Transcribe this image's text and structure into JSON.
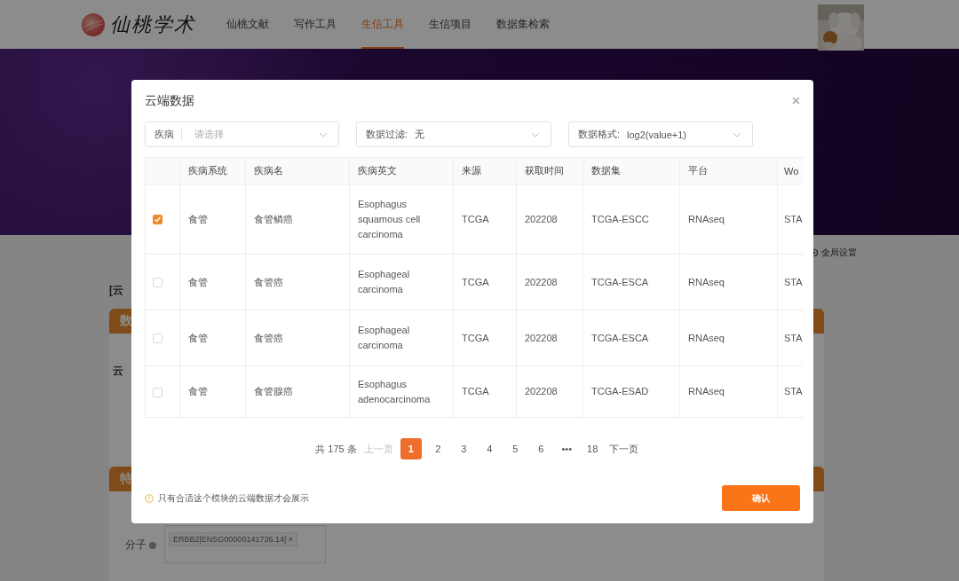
{
  "nav": {
    "logo_text": "仙桃学术",
    "items": [
      {
        "label": "仙桃文献",
        "selected": false
      },
      {
        "label": "写作工具",
        "selected": false
      },
      {
        "label": "生信工具",
        "selected": true
      },
      {
        "label": "生信项目",
        "selected": false
      },
      {
        "label": "数据集检索",
        "selected": false
      }
    ]
  },
  "page": {
    "settings_link": "全局设置",
    "heading": "[云",
    "panels": [
      {
        "header": "数",
        "field_label": "云"
      },
      {
        "header": "特",
        "field_label": "分子",
        "tag": "ERBB2|ENSG00000141736.14|",
        "tag_close": "×"
      }
    ]
  },
  "modal": {
    "title": "云端数据",
    "filters": [
      {
        "kind": "prefixed",
        "label": "疾病",
        "placeholder": "请选择"
      },
      {
        "kind": "inline",
        "label": "数据过滤:",
        "value": "无"
      },
      {
        "kind": "inline",
        "label": "数据格式:",
        "value": "log2(value+1)"
      }
    ],
    "table": {
      "columns": [
        "疾病系统",
        "疾病名",
        "疾病英文",
        "来源",
        "获取时间",
        "数据集",
        "平台",
        "Wo"
      ],
      "rows": [
        {
          "checked": true,
          "cells": [
            "食管",
            "食管鳞癌",
            "Esophagus squamous cell carcinoma",
            "TCGA",
            "202208",
            "TCGA-ESCC",
            "RNAseq",
            "STA"
          ]
        },
        {
          "checked": false,
          "cells": [
            "食管",
            "食管癌",
            "Esophageal carcinoma",
            "TCGA",
            "202208",
            "TCGA-ESCA",
            "RNAseq",
            "STA"
          ]
        },
        {
          "checked": false,
          "cells": [
            "食管",
            "食管癌",
            "Esophageal carcinoma",
            "TCGA",
            "202208",
            "TCGA-ESCA",
            "RNAseq",
            "STA"
          ]
        },
        {
          "checked": false,
          "cells": [
            "食管",
            "食管腺癌",
            "Esophagus adenocarcinoma",
            "TCGA",
            "202208",
            "TCGA-ESAD",
            "RNAseq",
            "STA"
          ]
        }
      ]
    },
    "pagination": {
      "total": "共 175 条",
      "prev": "上一页",
      "prev_disabled": true,
      "pages": [
        {
          "label": "1",
          "selected": true
        },
        {
          "label": "2",
          "selected": false
        },
        {
          "label": "3",
          "selected": false
        },
        {
          "label": "4",
          "selected": false
        },
        {
          "label": "5",
          "selected": false
        },
        {
          "label": "6",
          "selected": false
        },
        {
          "label": "•••",
          "selected": false
        },
        {
          "label": "18",
          "selected": false
        }
      ],
      "next": "下一页"
    },
    "note": "只有合适这个模块的云端数据才会展示",
    "confirm": "确认"
  }
}
